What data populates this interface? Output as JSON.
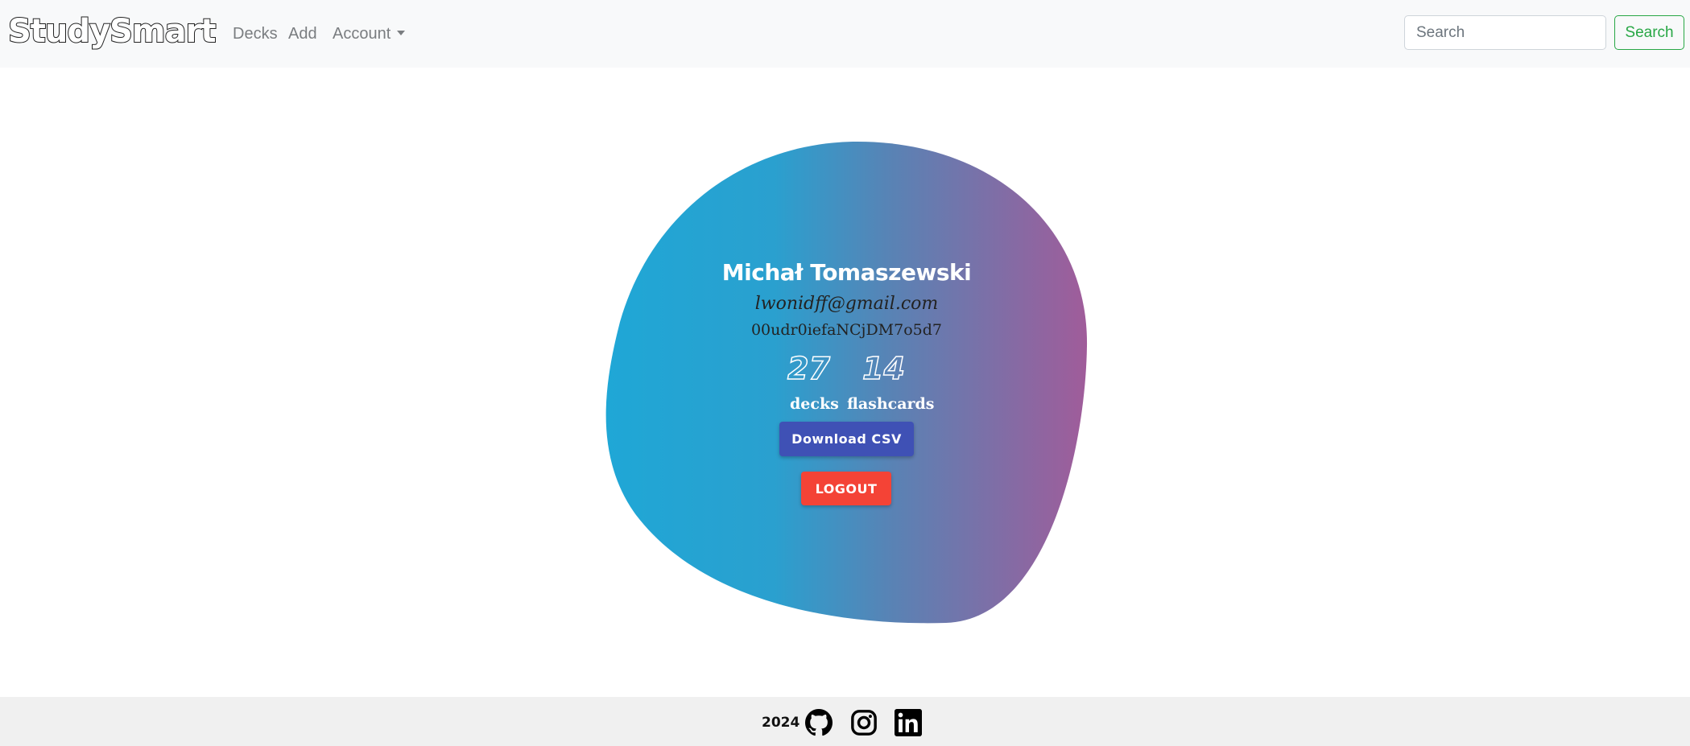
{
  "navbar": {
    "brand": "StudySmart",
    "links": [
      "Decks",
      "Add",
      "Account"
    ],
    "search": {
      "placeholder": "Search",
      "value": "",
      "button_label": "Search"
    }
  },
  "profile": {
    "name": "Michał Tomaszewski",
    "email": "lwonidff@gmail.com",
    "user_id": "00udr0iefaNCjDM7o5d7",
    "stats": {
      "decks_value": "27",
      "decks_label": "decks",
      "flashcards_value": "14",
      "flashcards_label": "flashcards"
    },
    "download_label": "Download CSV",
    "logout_label": "LOGOUT"
  },
  "footer": {
    "year": "2024",
    "icons": [
      "github-icon",
      "instagram-icon",
      "linkedin-icon"
    ]
  },
  "colors": {
    "navbar_bg": "#f8f9fa",
    "blob_start": "#1fa7d6",
    "blob_end": "#a05c9a",
    "csv_button": "#3f51b5",
    "logout_button": "#f44336",
    "search_outline": "#28a745",
    "footer_bg": "#f0f0f0"
  }
}
